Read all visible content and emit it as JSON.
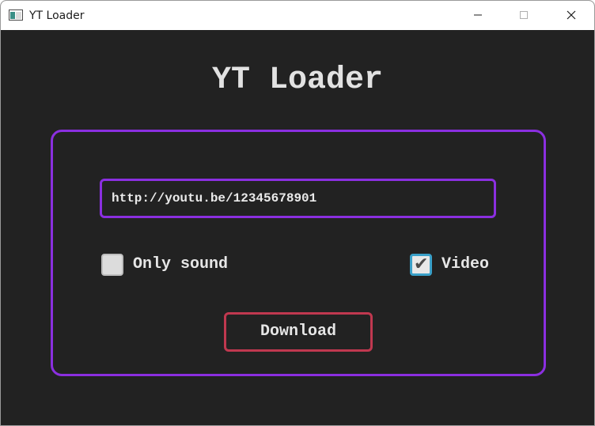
{
  "window": {
    "title": "YT Loader",
    "controls": [
      "minimize",
      "maximize",
      "close"
    ]
  },
  "app": {
    "heading": "YT Loader",
    "url_input": {
      "value": "http://youtu.be/12345678901",
      "placeholder": ""
    },
    "options": {
      "only_sound": {
        "label": "Only sound",
        "checked": false
      },
      "video": {
        "label": "Video",
        "checked": true
      }
    },
    "download_button": {
      "label": "Download"
    }
  },
  "colors": {
    "background": "#222222",
    "panel_border": "#8b2fe0",
    "download_border": "#c0384f",
    "checkbox_focus": "#3aa0c8",
    "text": "#e6e6e6"
  },
  "icons": {
    "app": "app-window-icon",
    "minimize": "minimize-icon",
    "maximize": "maximize-icon",
    "close": "close-icon",
    "check": "checkmark-icon"
  }
}
